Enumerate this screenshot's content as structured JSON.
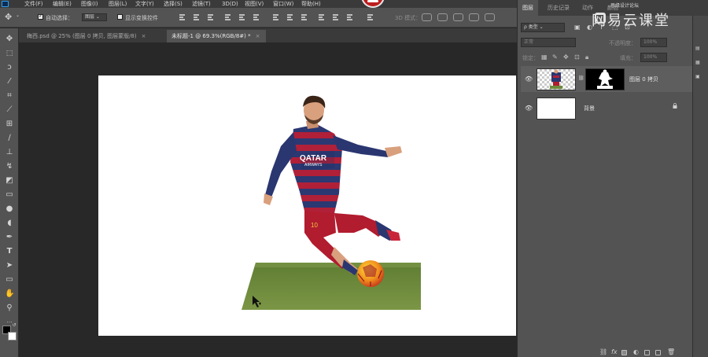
{
  "menu": {
    "items": [
      "文件(F)",
      "编辑(E)",
      "图像(I)",
      "图层(L)",
      "文字(Y)",
      "选择(S)",
      "滤镜(T)",
      "3D(D)",
      "视图(V)",
      "窗口(W)",
      "帮助(H)"
    ]
  },
  "options": {
    "auto_select_label": "自动选择：",
    "auto_select_target": "图层",
    "show_transform_label": "显示变换控件",
    "mode_3d_label": "3D 模式："
  },
  "tabs": [
    {
      "label": "梅西.psd @ 25% (图层 0 拷贝, 图层蒙版/8)",
      "active": false
    },
    {
      "label": "未标题-1 @ 69.3%(RGB/8#) *",
      "active": true
    }
  ],
  "layers_panel": {
    "tabs": [
      "图层",
      "历史记录",
      "动作",
      "颜色"
    ],
    "filter_kind": "ρ 类型",
    "blend_mode": "正常",
    "opacity_label": "不透明度：",
    "opacity_value": "100%",
    "lock_label": "锁定：",
    "fill_label": "填充：",
    "fill_value": "100%",
    "layers": [
      {
        "name": "图层 0 拷贝",
        "visible": true,
        "selected": true
      },
      {
        "name": "背景",
        "visible": true,
        "selected": false
      }
    ]
  },
  "watermark": {
    "brand": "网易云课堂",
    "sub": "思缘设计论坛"
  },
  "player_text": {
    "sponsor_line1": "QATAR",
    "sponsor_line2": "AIRWAYS",
    "number": "10"
  },
  "colors": {
    "canvas_bg": "#ffffff",
    "grass": "#6d8b3c",
    "jersey_blue": "#2a3670",
    "jersey_red": "#b3213a",
    "shorts_red": "#b11c2e",
    "skin": "#d9a07e"
  }
}
